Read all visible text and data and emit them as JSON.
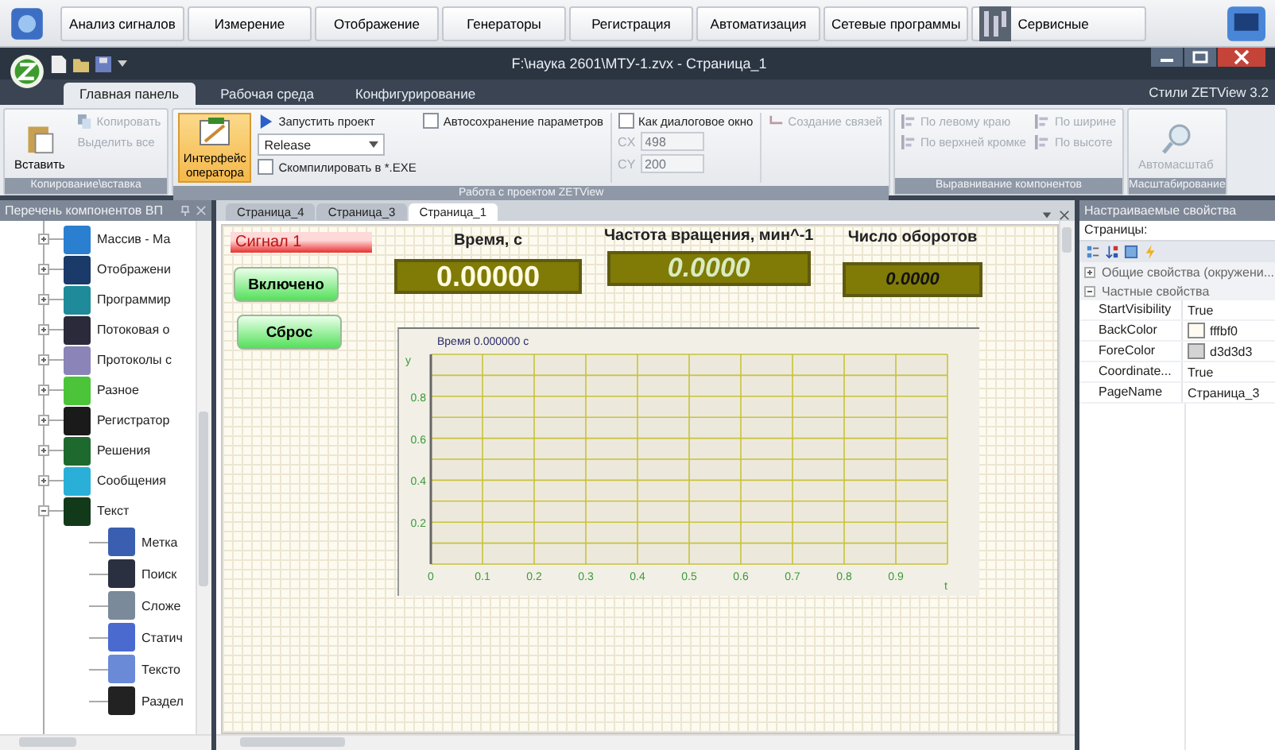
{
  "toolbar": {
    "buttons": [
      {
        "label": "Анализ сигналов",
        "kind": "text"
      },
      {
        "label": "Измерение",
        "kind": "text"
      },
      {
        "label": "Отображение",
        "kind": "text"
      },
      {
        "label": "Генераторы",
        "kind": "text"
      },
      {
        "label": "Регистрация",
        "kind": "text"
      },
      {
        "label": "Автоматизация",
        "kind": "text"
      },
      {
        "label": "Сетевые программы",
        "kind": "text"
      },
      {
        "label": "Сервисные",
        "kind": "icon"
      }
    ]
  },
  "window": {
    "title": "F:\\наука 2601\\МТУ-1.zvx - Страница_1"
  },
  "ribbon": {
    "tabs": [
      {
        "label": "Главная панель",
        "selected": true
      },
      {
        "label": "Рабочая среда",
        "selected": false
      },
      {
        "label": "Конфигурирование",
        "selected": false
      }
    ],
    "style_menu": "Стили ZETView 3.2",
    "clipboard": {
      "caption": "Копирование\\вставка",
      "paste": "Вставить",
      "copy": {
        "label": "Копировать",
        "disabled": true
      },
      "select_all": {
        "label": "Выделить все",
        "disabled": true
      }
    },
    "project": {
      "caption": "Работа с проектом ZETView",
      "operator": {
        "label": "Интерфейс оператора",
        "selected": true
      },
      "run": "Запустить проект",
      "config": "Release",
      "compile": {
        "label": "Скомпилировать в *.EXE",
        "checked": false
      },
      "autosave": {
        "label": "Автосохранение параметров",
        "checked": false
      },
      "dialog": {
        "label": "Как диалоговое окно",
        "checked": false
      },
      "cx": {
        "label": "CX",
        "value": "498",
        "disabled": true
      },
      "cy": {
        "label": "CY",
        "value": "200",
        "disabled": true
      },
      "links": {
        "label": "Создание связей",
        "disabled": true
      }
    },
    "align": {
      "caption": "Выравнивание компонентов",
      "items": [
        {
          "label": "По левому краю",
          "disabled": true
        },
        {
          "label": "По верхней кромке",
          "disabled": true
        },
        {
          "label": "По ширине",
          "disabled": true
        },
        {
          "label": "По высоте",
          "disabled": true
        }
      ]
    },
    "zoom": {
      "caption": "Масштабирование",
      "auto": {
        "label": "Автомасштаб",
        "disabled": true
      }
    }
  },
  "components_panel": {
    "title": "Перечень компонентов ВП",
    "items": [
      {
        "label": "Массив - Ма",
        "color": "#2a7fd0",
        "expanded": false
      },
      {
        "label": "Отображени",
        "color": "#1a3a6a",
        "expanded": false
      },
      {
        "label": "Программир",
        "color": "#1f8a9a",
        "expanded": false
      },
      {
        "label": "Потоковая о",
        "color": "#2a2a3a",
        "expanded": false
      },
      {
        "label": "Протоколы с",
        "color": "#8a84b8",
        "expanded": false
      },
      {
        "label": "Разное",
        "color": "#4cc43a",
        "expanded": false
      },
      {
        "label": "Регистратор",
        "color": "#1a1a1a",
        "expanded": false
      },
      {
        "label": "Решения",
        "color": "#1e6a2e",
        "expanded": false
      },
      {
        "label": "Сообщения",
        "color": "#2ab0d8",
        "expanded": false
      },
      {
        "label": "Текст",
        "color": "#123a1a",
        "expanded": true,
        "children": [
          {
            "label": "Метка",
            "color": "#3a5fb0"
          },
          {
            "label": "Поиск",
            "color": "#2a3040"
          },
          {
            "label": "Сложе",
            "color": "#7a8a9a"
          },
          {
            "label": "Статич",
            "color": "#4a6ad0"
          },
          {
            "label": "Тексто",
            "color": "#6a8ad8"
          },
          {
            "label": "Раздел",
            "color": "#222222"
          }
        ]
      }
    ]
  },
  "document": {
    "tabs": [
      {
        "label": "Страница_4",
        "selected": false
      },
      {
        "label": "Страница_3",
        "selected": false
      },
      {
        "label": "Страница_1",
        "selected": true
      }
    ],
    "signal": "Сигнал 1",
    "buttons": [
      "Включено",
      "Сброс"
    ],
    "displays": [
      {
        "label": "Время, с",
        "value": "0.00000",
        "kind": "large"
      },
      {
        "label": "Частота вращения, мин^-1",
        "value": "0.0000",
        "kind": "italic"
      },
      {
        "label": "Число оборотов",
        "value": "0.0000",
        "kind": "small"
      }
    ],
    "chart_data": {
      "type": "line",
      "grid": true,
      "title": "Время 0.000000 с",
      "xlabel": "t",
      "ylabel": "y",
      "xlim": [
        0,
        1
      ],
      "ylim": [
        0,
        1
      ],
      "xticks": [
        0,
        0.1,
        0.2,
        0.3,
        0.4,
        0.5,
        0.6,
        0.7,
        0.8,
        0.9
      ],
      "yticks": [
        0.2,
        0.4,
        0.6,
        0.8
      ]
    }
  },
  "properties_panel": {
    "title": "Настраиваемые свойства",
    "object": "Страницы:",
    "categories": [
      {
        "label": "Общие свойства (окружени...",
        "expanded": false
      },
      {
        "label": "Частные свойства",
        "expanded": true,
        "properties": [
          {
            "name": "StartVisibility",
            "value": "True"
          },
          {
            "name": "BackColor",
            "value": "fffbf0",
            "color": "#fffbf0"
          },
          {
            "name": "ForeColor",
            "value": "d3d3d3",
            "color": "#d3d3d3"
          },
          {
            "name": "Coordinate...",
            "value": "True"
          },
          {
            "name": "PageName",
            "value": "Страница_3"
          }
        ]
      }
    ]
  }
}
